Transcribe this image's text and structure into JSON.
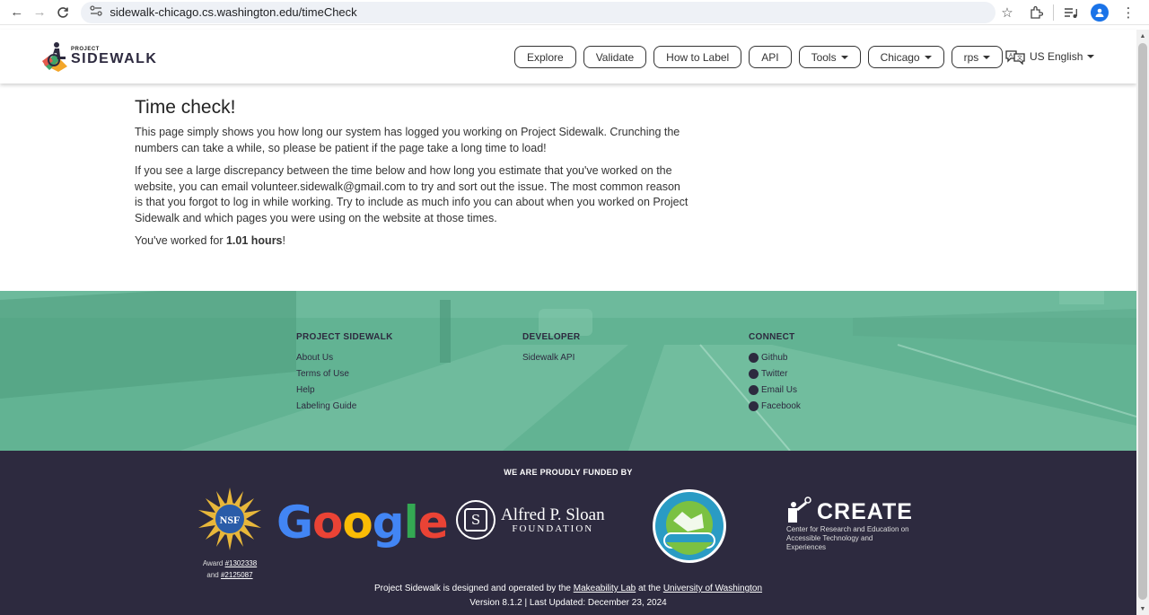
{
  "browser": {
    "back": "←",
    "forward": "→",
    "reload": "C",
    "url": "sidewalk-chicago.cs.washington.edu/timeCheck",
    "profile_initial": "●"
  },
  "header": {
    "logo_small": "PROJECT",
    "logo_big": "SIDEWALK",
    "nav": [
      {
        "label": "Explore"
      },
      {
        "label": "Validate"
      },
      {
        "label": "How to Label"
      },
      {
        "label": "API"
      },
      {
        "label": "Tools"
      },
      {
        "label": "Chicago"
      },
      {
        "label": "rps"
      }
    ],
    "language": "US English"
  },
  "main": {
    "title": "Time check!",
    "para1": "This page simply shows you how long our system has logged you working on Project Sidewalk. Crunching the numbers can take a while, so please be patient if the page take a long time to load!",
    "para2": "If you see a large discrepancy between the time below and how long you estimate that you've worked on the website, you can email volunteer.sidewalk@gmail.com to try and sort out the issue. The most common reason is that you forgot to log in while working. Try to include as much info you can about when you worked on Project Sidewalk and which pages you were using on the website at those times.",
    "worked_prefix": "You've worked for ",
    "worked_value": "1.01 hours",
    "worked_suffix": "!"
  },
  "footer": {
    "col1": {
      "title": "PROJECT SIDEWALK",
      "links": [
        "About Us",
        "Terms of Use",
        "Help",
        "Labeling Guide"
      ]
    },
    "col2": {
      "title": "DEVELOPER",
      "links": [
        "Sidewalk API"
      ]
    },
    "col3": {
      "title": "CONNECT",
      "links": [
        "Github",
        "Twitter",
        "Email Us",
        "Facebook"
      ]
    },
    "funded_by": "WE ARE PROUDLY FUNDED BY",
    "nsf_award_prefix": "Award ",
    "nsf_award_1": "#1302338",
    "nsf_and": "and ",
    "nsf_award_2": "#2125087",
    "google": [
      "G",
      "o",
      "o",
      "g",
      "l",
      "e"
    ],
    "sloan_name": "Alfred P. Sloan",
    "sloan_foundation": "FOUNDATION",
    "create_word": "CREATE",
    "create_sub": "Center for Research and Education on Accessible Technology and Experiences",
    "credits_prefix": "Project Sidewalk is designed and operated by the ",
    "credits_lab": "Makeability Lab",
    "credits_mid": " at the ",
    "credits_uw": "University of Washington",
    "version": "Version 8.1.2 | Last Updated: December 23, 2024"
  },
  "colors": {
    "footer_green": "#62b393",
    "footer_dark": "#2d2a3f",
    "google_blue": "#4285F4",
    "google_red": "#EA4335",
    "google_yellow": "#FBBC05",
    "google_green": "#34A853"
  }
}
